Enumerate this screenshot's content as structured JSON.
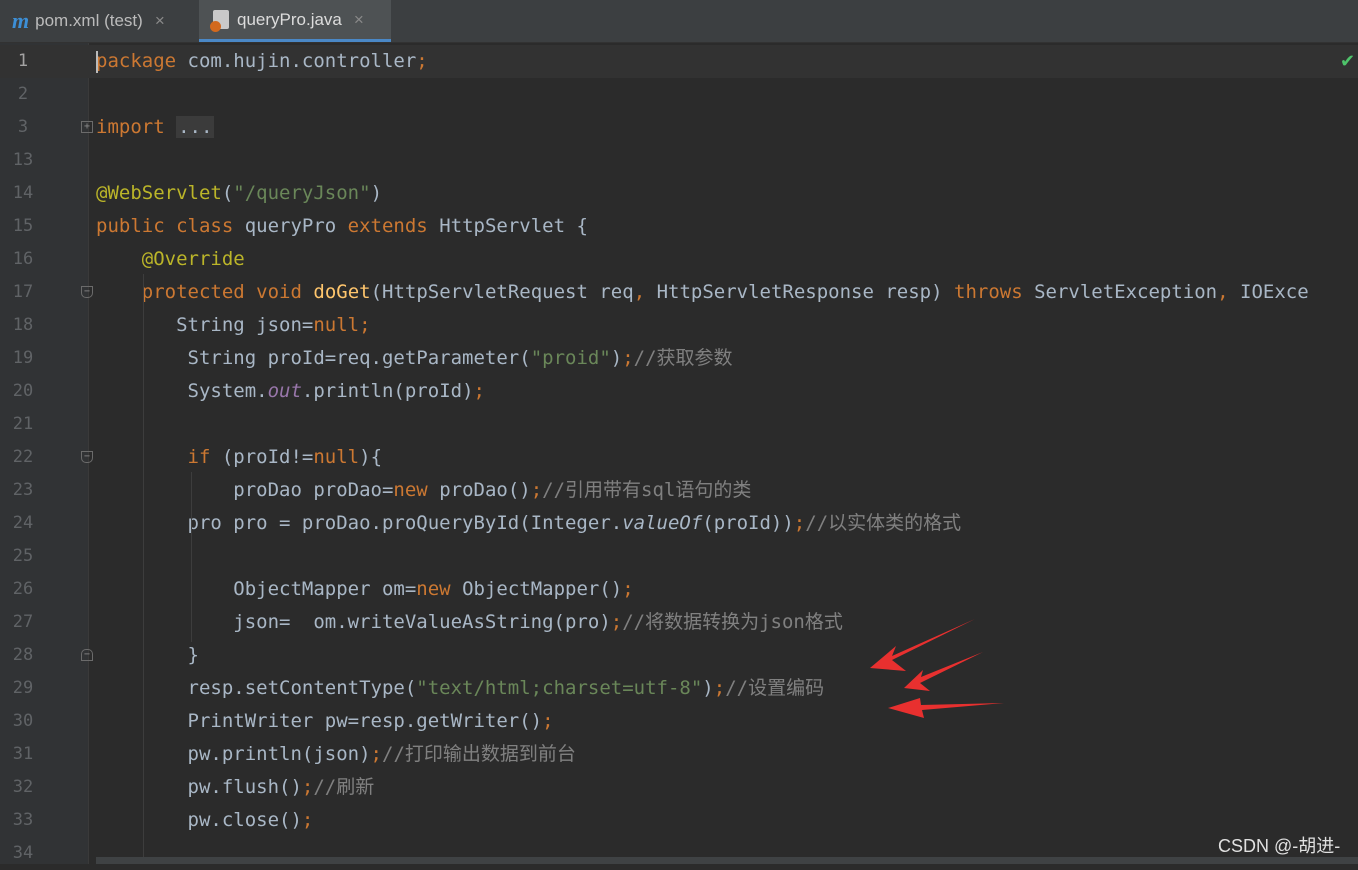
{
  "tabs": [
    {
      "label": "pom.xml (test)",
      "icon": "maven-icon",
      "close": "×"
    },
    {
      "label": "queryPro.java",
      "icon": "java-file-icon",
      "close": "×"
    }
  ],
  "editor": {
    "lines": [
      {
        "n": "1",
        "html": "<span class=\"kw\">package</span> com.hujin.controller<span class=\"kw\">;</span>"
      },
      {
        "n": "2",
        "html": ""
      },
      {
        "n": "3",
        "html": "<span class=\"kw\">import</span> <span class=\"fold-box\">...</span>"
      },
      {
        "n": "13",
        "html": ""
      },
      {
        "n": "14",
        "html": "<span class=\"ann\">@WebServlet</span>(<span class=\"str\">\"/queryJson\"</span>)"
      },
      {
        "n": "15",
        "html": "<span class=\"kw\">public class</span> queryPro <span class=\"kw\">extends</span> HttpServlet {"
      },
      {
        "n": "16",
        "html": "    <span class=\"ann\">@Override</span>"
      },
      {
        "n": "17",
        "html": "    <span class=\"kw\">protected void</span> <span class=\"fn\">doGet</span>(HttpServletRequest req<span class=\"kw\">,</span> HttpServletResponse resp) <span class=\"kw\">throws</span> ServletException<span class=\"kw\">,</span> IOExce"
      },
      {
        "n": "18",
        "html": "       String json=<span class=\"kw\">null;</span>"
      },
      {
        "n": "19",
        "html": "        String proId=req.getParameter(<span class=\"str\">\"proid\"</span>)<span class=\"kw\">;</span><span class=\"cmt-g\">//获取参数</span>"
      },
      {
        "n": "20",
        "html": "        System.<span style=\"color:#9876aa;font-style:italic\">out</span>.println(proId)<span class=\"kw\">;</span>"
      },
      {
        "n": "21",
        "html": ""
      },
      {
        "n": "22",
        "html": "        <span class=\"kw\">if</span> (proId!=<span class=\"kw\">null</span>){"
      },
      {
        "n": "23",
        "html": "            proDao proDao=<span class=\"kw\">new</span> proDao()<span class=\"kw\">;</span><span class=\"cmt-g\">//引用带有sql语句的类</span>"
      },
      {
        "n": "24",
        "html": "        pro pro = proDao.proQueryById(Integer.<span style=\"font-style:italic\">valueOf</span>(proId))<span class=\"kw\">;</span><span class=\"cmt-g\">//以实体类的格式</span>"
      },
      {
        "n": "25",
        "html": ""
      },
      {
        "n": "26",
        "html": "            ObjectMapper om=<span class=\"kw\">new</span> ObjectMapper()<span class=\"kw\">;</span>"
      },
      {
        "n": "27",
        "html": "            json=  om.writeValueAsString(pro)<span class=\"kw\">;</span><span class=\"cmt-g\">//将数据转换为json格式</span>"
      },
      {
        "n": "28",
        "html": "        }"
      },
      {
        "n": "29",
        "html": "        resp.setContentType(<span class=\"str\">\"text/html;charset=utf-8\"</span>)<span class=\"kw\">;</span><span class=\"cmt-g\">//设置编码</span>"
      },
      {
        "n": "30",
        "html": "        PrintWriter pw=resp.getWriter()<span class=\"kw\">;</span>"
      },
      {
        "n": "31",
        "html": "        pw.println(json)<span class=\"kw\">;</span><span class=\"cmt-g\">//打印输出数据到前台</span>"
      },
      {
        "n": "32",
        "html": "        pw.flush()<span class=\"kw\">;</span><span class=\"cmt-g\">//刷新</span>"
      },
      {
        "n": "33",
        "html": "        pw.close()<span class=\"kw\">;</span>"
      },
      {
        "n": "34",
        "html": ""
      }
    ]
  },
  "status": {
    "inspection": "✔"
  },
  "watermark": "CSDN @-胡进-",
  "colors": {
    "keyword": "#cc7832",
    "string": "#6a8759",
    "annotation": "#bbb529",
    "comment": "#808080",
    "arrow": "#e8302f"
  }
}
